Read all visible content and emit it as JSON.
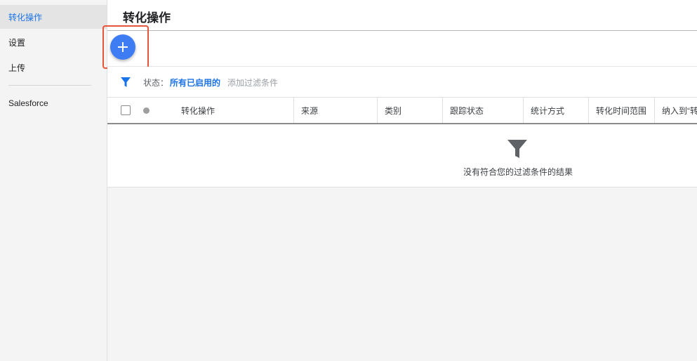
{
  "sidebar": {
    "items": [
      {
        "label": "转化操作"
      },
      {
        "label": "设置"
      },
      {
        "label": "上传"
      },
      {
        "label": "Salesforce"
      }
    ]
  },
  "header": {
    "title": "转化操作"
  },
  "toolbar": {
    "add_icon": "plus-icon"
  },
  "filter": {
    "label": "状态：",
    "value": "所有已启用的",
    "add": "添加过滤条件"
  },
  "table": {
    "columns": [
      "转化操作",
      "来源",
      "类别",
      "跟踪状态",
      "统计方式",
      "转化时间范围",
      "纳入到“转"
    ],
    "empty_message": "没有符合您的过滤条件的结果"
  },
  "colors": {
    "accent": "#1a73e8",
    "fab": "#3d7cf3",
    "highlight": "#e8543a"
  }
}
